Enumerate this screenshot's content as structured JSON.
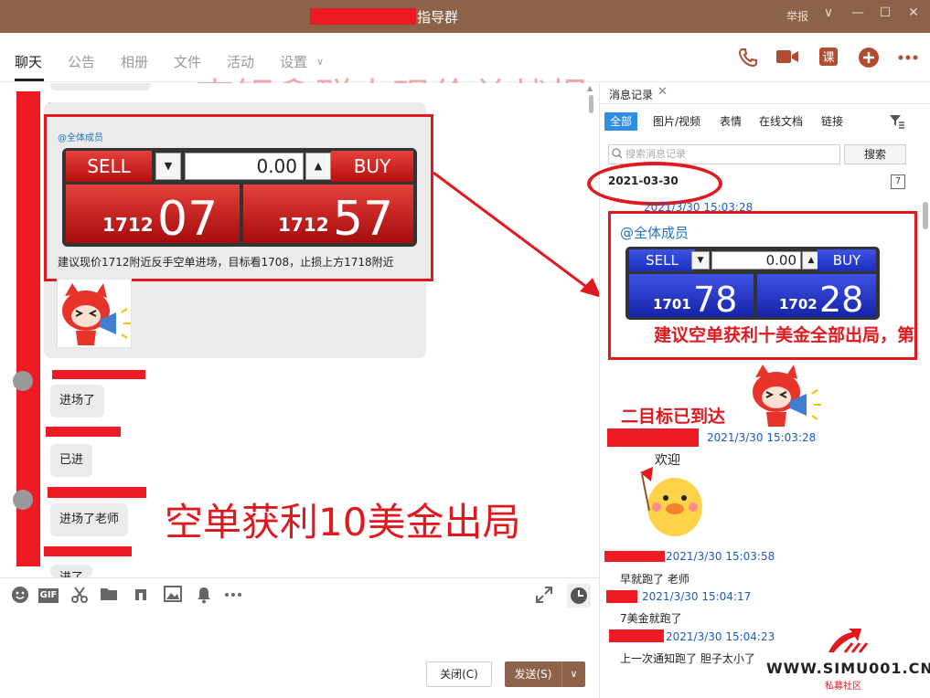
{
  "window": {
    "title": "指导群",
    "report": "举报",
    "controls": {
      "menu": "∨",
      "minimize": "—",
      "maximize": "☐",
      "close": "✕"
    }
  },
  "nav": {
    "tabs": [
      "聊天",
      "公告",
      "相册",
      "文件",
      "活动",
      "设置"
    ],
    "settings_caret": "∨"
  },
  "overlay": {
    "title": "李钜鑫群内现价单战报",
    "result": "空单获利10美金出局"
  },
  "chat": {
    "quote": {
      "at_all": "@全体成员",
      "sell": "SELL",
      "buy": "BUY",
      "amount": "0.00",
      "down_arrow": "▼",
      "up_arrow": "▲",
      "sell_prefix": "1712",
      "sell_big": "07",
      "buy_prefix": "1712",
      "buy_big": "57",
      "desc": "建议现价1712附近反手空单进场，目标看1708，止损上方1718附近"
    },
    "messages": [
      "进场了",
      "已进",
      "进场了老师",
      "进了"
    ]
  },
  "toolbar": {
    "icons": [
      "emoji-icon",
      "gif-icon",
      "scissors-icon",
      "folder-icon",
      "music-icon",
      "image-icon",
      "bell-icon",
      "more-icon"
    ],
    "gif": "GIF",
    "close_button": "关闭(C)",
    "send_button": "发送(S)",
    "send_more": "∨"
  },
  "history": {
    "tab_label": "消息记录",
    "tab_close": "✕",
    "filters": [
      "全部",
      "图片/视频",
      "表情",
      "在线文档",
      "链接"
    ],
    "search_placeholder": "搜索消息记录",
    "search_button": "搜索",
    "date": "2021-03-30",
    "calendar_day": "7",
    "entries": [
      {
        "time": "2021/3/30 15:03:28"
      },
      {
        "time": "2021/3/30 15:03:28"
      },
      {
        "time": "2021/3/30 15:03:58",
        "text": "早就跑了 老师"
      },
      {
        "time": "2021/3/30 15:04:17",
        "text": "7美金就跑了"
      },
      {
        "time": "2021/3/30 15:04:23",
        "text": "上一次通知跑了 胆子太小了"
      }
    ],
    "quote": {
      "at_all": "@全体成员",
      "sell": "SELL",
      "buy": "BUY",
      "amount": "0.00",
      "down_arrow": "▼",
      "up_arrow": "▲",
      "sell_prefix": "1701",
      "sell_big": "78",
      "buy_prefix": "1702",
      "buy_big": "28",
      "message": "建议空单获利十美金全部出局，第"
    },
    "overlay": "二目标已到达",
    "welcome": "欢迎"
  },
  "watermark": {
    "site": "WWW.SIMU001.CN",
    "sub": "私募社区"
  },
  "colors": {
    "titlebar": "#8c6248",
    "redaction": "#ee1b24",
    "annotation": "#e0191f",
    "link_blue": "#1e58c8"
  }
}
